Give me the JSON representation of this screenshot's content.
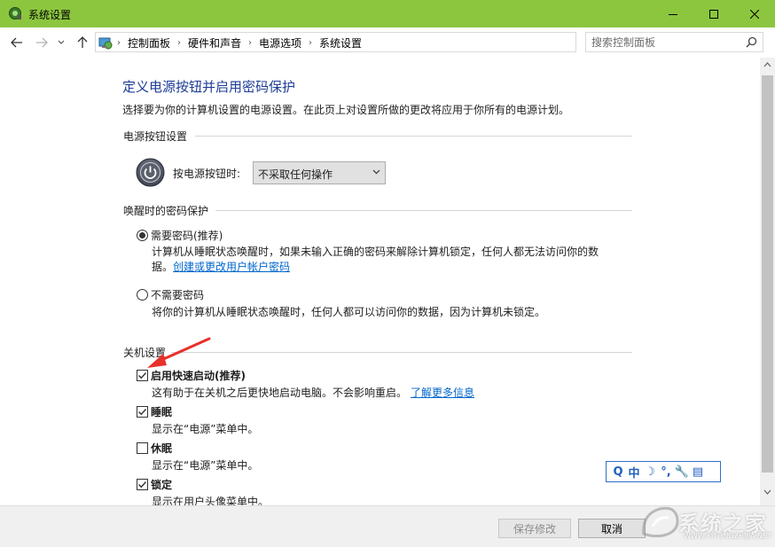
{
  "window": {
    "title": "系统设置"
  },
  "address": {
    "breadcrumbs": [
      "控制面板",
      "硬件和声音",
      "电源选项",
      "系统设置"
    ],
    "search_placeholder": "搜索控制面板"
  },
  "page": {
    "title": "定义电源按钮并启用密码保护",
    "description": "选择要为你的计算机设置的电源设置。在此页上对设置所做的更改将应用于你所有的电源计划。"
  },
  "power_button": {
    "section": "电源按钮设置",
    "label": "按电源按钮时:",
    "selected": "不采取任何操作"
  },
  "password": {
    "section": "唤醒时的密码保护",
    "require": {
      "title": "需要密码(推荐)",
      "desc_line1": "计算机从睡眠状态唤醒时，如果未输入正确的密码来解除计算机锁定，任何人都无法访问你的数",
      "desc_line2_prefix": "据。",
      "link": "创建或更改用户帐户密码",
      "selected": true
    },
    "no_require": {
      "title": "不需要密码",
      "desc": "将你的计算机从睡眠状态唤醒时，任何人都可以访问你的数据，因为计算机未锁定。",
      "selected": false
    }
  },
  "shutdown": {
    "section": "关机设置",
    "fast_startup": {
      "title": "启用快速启动(推荐)",
      "desc": "这有助于在关机之后更快地启动电脑。不会影响重启。",
      "link": "了解更多信息",
      "checked": true
    },
    "sleep": {
      "title": "睡眠",
      "desc": "显示在“电源”菜单中。",
      "checked": true
    },
    "hibernate": {
      "title": "休眠",
      "desc": "显示在“电源”菜单中。",
      "checked": false
    },
    "lock": {
      "title": "锁定",
      "desc": "显示在用户头像菜单中。",
      "checked": true
    }
  },
  "buttons": {
    "save": "保存修改",
    "cancel": "取消"
  },
  "ime": {
    "items": [
      "Q",
      "中",
      "☽",
      "°,",
      "🔧",
      "▤"
    ]
  },
  "watermark": {
    "text": "系统之家",
    "url": "WWW.XITONGZHIJIA.NET"
  },
  "colors": {
    "titlebar": "#8cc63f",
    "page_title": "#1e3c96",
    "link": "#0066cc",
    "arrow": "#e8302a"
  }
}
